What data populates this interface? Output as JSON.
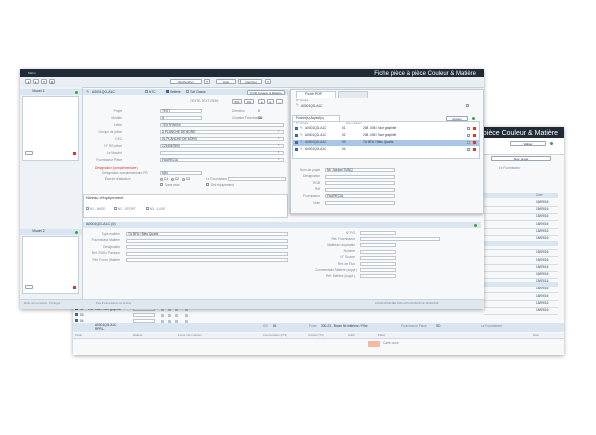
{
  "back_window": {
    "title": "Fiche pièce à pièce Couleur & Matière",
    "save_button": "Valider",
    "user_button": "Suiv. projet",
    "filters_label": "Le Fournisseur",
    "col_date": "Date",
    "dates": [
      "15/09/16",
      "15/09/16",
      "15/09/16",
      "15/09/16",
      "15/09/16",
      "15/09/16",
      "15/09/16",
      "15/09/16",
      "15/09/16",
      "15/09/16",
      "15/09/16",
      "15/09/16",
      "15/09/16",
      "15/09/16",
      "15/09/16",
      "15/09/16"
    ],
    "bottom_rows": [
      {
        "code": "02",
        "text": "208 .008 / Noir graphité"
      },
      {
        "code": "03",
        "text": ""
      },
      {
        "code": "04",
        "text": ""
      }
    ],
    "group_row": {
      "ref": "A0001QG-A1C",
      "ref2": "RPRL-",
      "scale": "GS",
      "scale_val": "81",
      "form": "Form",
      "form_val": "300-23 - Boom fin intérieur / Film",
      "supplier": "Fournisseur Place",
      "supplier_val": "SD",
      "role": "Le Fournisseur"
    },
    "table_headers": [
      "Tarde",
      "Matière",
      "Fours / Ab matériel",
      "Commentaire (N°2)",
      "Couleur (T1)",
      "Addit.",
      "Placé",
      "Date"
    ],
    "highlight_text": "Carte ouve"
  },
  "main_window": {
    "app_name": "Métro",
    "title": "Fiche pièce à pièce Couleur & Matière",
    "toolbar": {
      "search": "Rechercher",
      "list": "Liste",
      "export": "Imprimer"
    },
    "left_panel": {
      "visual1_label": "Visuel 1",
      "visual2_label": "Visuel 2"
    },
    "header": {
      "ref": "A0001QG-A1C",
      "opt_ntc": "NTC",
      "opt_sellerie": "Sellerie",
      "opt_toit": "Toit Classe",
      "profile_button": "Profil Couleur & Matière",
      "code_label": "TEXTE-TEXT-REMI",
      "num1": "061",
      "num2": "161"
    },
    "form": {
      "rows": [
        {
          "label": "Projet",
          "value": "TEST",
          "label2": "Direction",
          "value2": "0"
        },
        {
          "label": "Modèle",
          "value": "A",
          "label2": "Chantier Fournisseur",
          "value2": "SD"
        },
        {
          "label": "Lettre",
          "value": "TESTFIN000",
          "label2": "",
          "value2": ""
        },
        {
          "label": "Groupe de pièce",
          "value": "A PLANCHE DE BORD",
          "label2": "",
          "value2": ""
        },
        {
          "label": "CEC",
          "value": "01 PLANCHE DE BORD",
          "label2": "",
          "value2": ""
        },
        {
          "label": "N° RG pièce",
          "value": "1234567890",
          "label2": "",
          "value2": ""
        },
        {
          "label": "Le Marché",
          "value": "",
          "label2": "",
          "value2": ""
        },
        {
          "label": "Fournisseur Pièce",
          "value": "FAURECIA",
          "label2": "",
          "value2": ""
        }
      ],
      "warning": "Désignation (complémentaire)",
      "designation_label": "Désignation complémentaire PR",
      "designation_value": "MAI",
      "state_label": "État de réalisation",
      "state_options": [
        "C1",
        "C2",
        "C3"
      ],
      "fournisseur_label": "Le Fournisseur",
      "check_left": "Sans esse",
      "check_right": "Sell équipement"
    },
    "level": {
      "title": "Niveau d'équipement",
      "opt1": "N1 - BASE",
      "opt2": "N2 - SPORT",
      "opt3": "N3 - LUXE"
    },
    "piece": {
      "ref": "A0001QG-A1C (0)",
      "fields": [
        {
          "label": "Type matière",
          "value": "TU BFA / Bleu Quartz"
        },
        {
          "label": "Fournisseur Matière",
          "value": ""
        },
        {
          "label": "Désignation",
          "value": ""
        },
        {
          "label": "Réf. RGB / Pantone",
          "value": ""
        },
        {
          "label": "Réf. Fourn. Matière",
          "value": ""
        }
      ],
      "right_fields": [
        {
          "label": "N° PO",
          "value": ""
        },
        {
          "label": "Réf. Fournisseur",
          "value": ""
        },
        {
          "label": "Matériau recyclable",
          "value": ""
        },
        {
          "label": "Nombre",
          "value": ""
        },
        {
          "label": "N° Source",
          "value": ""
        },
        {
          "label": "Réf. de Flux",
          "value": ""
        },
        {
          "label": "Commentaire Matière (suppl.)",
          "value": ""
        },
        {
          "label": "Réf. Matière (suppl.)",
          "value": ""
        }
      ]
    },
    "status": {
      "left": "Mode non connecté · Prototype",
      "mid": "Plus d'informations sur la fiche",
      "right": "FICHE MODIFIÉE PAR LUTILISATEUR LE 15/09/2016"
    },
    "popup": {
      "tab1": "Fiche POF",
      "tab2": "",
      "ref_label": "N° Groupe",
      "ref": "A0001QG-A1C",
      "list_tab": "Pochet(s) Aspect(s)",
      "list_button": "Ajouter",
      "col_ref": "N° Groupe",
      "col_name": "Nom / Aspect",
      "col_sel": "",
      "col_x": "",
      "items": [
        {
          "ref": "A0001QG-A1C",
          "num": "01",
          "name": "208 .008 / Noir graphité",
          "checked": true
        },
        {
          "ref": "A0001QG-A1C",
          "num": "02",
          "name": "208 .008 / Noir graphité",
          "checked": true
        },
        {
          "ref": "A0001QG-A1C",
          "num": "03",
          "name": "TU BFA / Bleu Quartz",
          "checked": true
        },
        {
          "ref": "A0001QG-A1C",
          "num": "04",
          "name": "",
          "checked": true
        }
      ],
      "fields": [
        {
          "label": "Nom de projet",
          "value": "Mr. Jaxaan SUNQ"
        },
        {
          "label": "Désignation",
          "value": ""
        },
        {
          "label": "RGB",
          "value": ""
        },
        {
          "label": "Réf",
          "value": ""
        },
        {
          "label": "Fournisseur",
          "value": "FAURECIA"
        },
        {
          "label": "Note",
          "value": ""
        }
      ]
    }
  },
  "colors": {
    "titlebar": "#1f2b37",
    "accent": "#4b79a8",
    "delete": "#d43a2a",
    "add": "#3aa34a",
    "highlight": "#f4b8a3"
  }
}
